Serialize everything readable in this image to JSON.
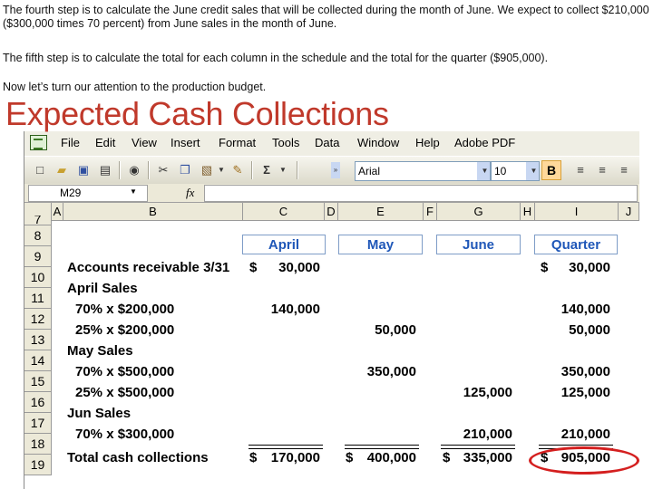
{
  "notes": {
    "p1": "The fourth step is to calculate the June credit sales that will be collected during the month of June. We expect to collect $210,000 ($300,000 times 70 percent) from June sales in the month of June.",
    "p2": "The fifth step is to calculate the total for each column in the schedule and the total for the quarter ($905,000).",
    "p3": "Now let’s turn our attention to the production budget."
  },
  "slide_title": "Expected Cash Collections",
  "menu": [
    "File",
    "Edit",
    "View",
    "Insert",
    "Format",
    "Tools",
    "Data",
    "Window",
    "Help",
    "Adobe PDF"
  ],
  "toolbar": {
    "font_name": "Arial",
    "font_size": "10",
    "bold_label": "B",
    "sum_label": "Σ"
  },
  "name_box": "M29",
  "fx_label": "fx",
  "columns": [
    "A",
    "B",
    "C",
    "D",
    "E",
    "F",
    "G",
    "H",
    "I",
    "J"
  ],
  "row_numbers": [
    "7",
    "8",
    "9",
    "10",
    "11",
    "12",
    "13",
    "14",
    "15",
    "16",
    "17",
    "18",
    "19"
  ],
  "headers": {
    "april": "April",
    "may": "May",
    "june": "June",
    "quarter": "Quarter"
  },
  "rows": {
    "r9": {
      "label": "Accounts receivable 3/31",
      "c_dollar": "$",
      "c": "30,000",
      "i_dollar": "$",
      "i": "30,000"
    },
    "r10": {
      "label": "April Sales"
    },
    "r11": {
      "label": "70% x $200,000",
      "c": "140,000",
      "i": "140,000"
    },
    "r12": {
      "label": "25% x $200,000",
      "e": "50,000",
      "i": "50,000"
    },
    "r13": {
      "label": "May Sales"
    },
    "r14": {
      "label": "70% x $500,000",
      "e": "350,000",
      "i": "350,000"
    },
    "r15": {
      "label": "25% x $500,000",
      "g": "125,000",
      "i": "125,000"
    },
    "r16": {
      "label": "Jun Sales"
    },
    "r17": {
      "label": "70% x $300,000",
      "g": "210,000",
      "i": "210,000"
    },
    "r18": {
      "label": "Total cash collections",
      "c_dollar": "$",
      "c": "170,000",
      "e_dollar": "$",
      "e": "400,000",
      "g_dollar": "$",
      "g": "335,000",
      "i_dollar": "$",
      "i": "905,000"
    }
  },
  "colors": {
    "title": "#c0392b",
    "header_text": "#1f57b8",
    "highlight": "#d41f1f"
  }
}
